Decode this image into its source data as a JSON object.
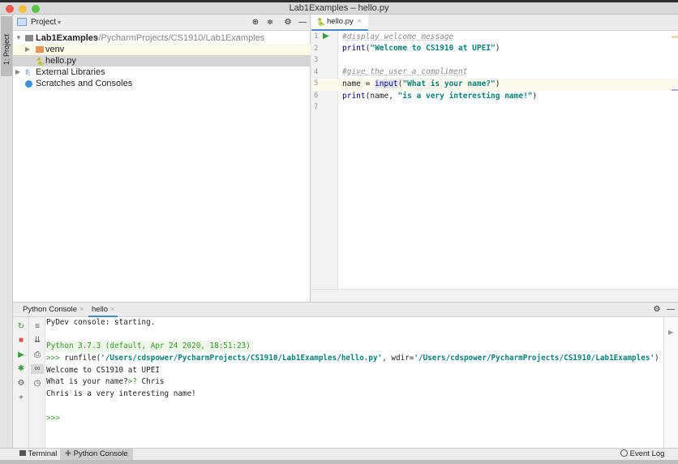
{
  "window": {
    "title": "Lab1Examples – hello.py"
  },
  "left_strip": {
    "project_tab": "1: Project"
  },
  "project": {
    "header_label": "Project",
    "root": {
      "name": "Lab1Examples",
      "path": "~/PycharmProjects/CS1910/Lab1Examples"
    },
    "items": [
      {
        "name": "venv"
      },
      {
        "name": "hello.py"
      }
    ],
    "external": "External Libraries",
    "scratches": "Scratches and Consoles"
  },
  "editor": {
    "tab": "hello.py",
    "line_numbers": [
      "1",
      "2",
      "3",
      "4",
      "5",
      "6",
      "7"
    ],
    "lines": {
      "l1": "#display welcome message",
      "l2_fn": "print",
      "l2_open": "(",
      "l2_str": "\"Welcome to CS1910 at UPEI\"",
      "l2_close": ")",
      "l4": "#give the user a compliment",
      "l5_a": "name = ",
      "l5_fn": "input",
      "l5_open": "(",
      "l5_str": "\"What is your name?\"",
      "l5_close": ")",
      "l6_fn": "print",
      "l6_a": "(name, ",
      "l6_str": "\"is a very interesting name!\"",
      "l6_close": ")"
    }
  },
  "console": {
    "tabs": [
      "Python Console",
      "hello"
    ],
    "lines": {
      "starting": "PyDev console: starting.",
      "version": "Python 3.7.3 (default, Apr 24 2020, 18:51:23)",
      "prompt": ">>> ",
      "runfile_a": "runfile(",
      "runfile_path": "'/Users/cdspower/PycharmProjects/CS1910/Lab1Examples/hello.py'",
      "runfile_b": ", wdir=",
      "runfile_wdir": "'/Users/cdspower/PycharmProjects/CS1910/Lab1Examples'",
      "runfile_c": ")",
      "welcome": "Welcome to CS1910 at UPEI",
      "ask": "What is your name?",
      "ask_prompt": ">? ",
      "answer": "Chris",
      "result": "Chris is a very interesting name!",
      "final_prompt": ">>>"
    }
  },
  "status_bar": {
    "terminal": "Terminal",
    "python_console": "Python Console",
    "event_log": "Event Log"
  }
}
